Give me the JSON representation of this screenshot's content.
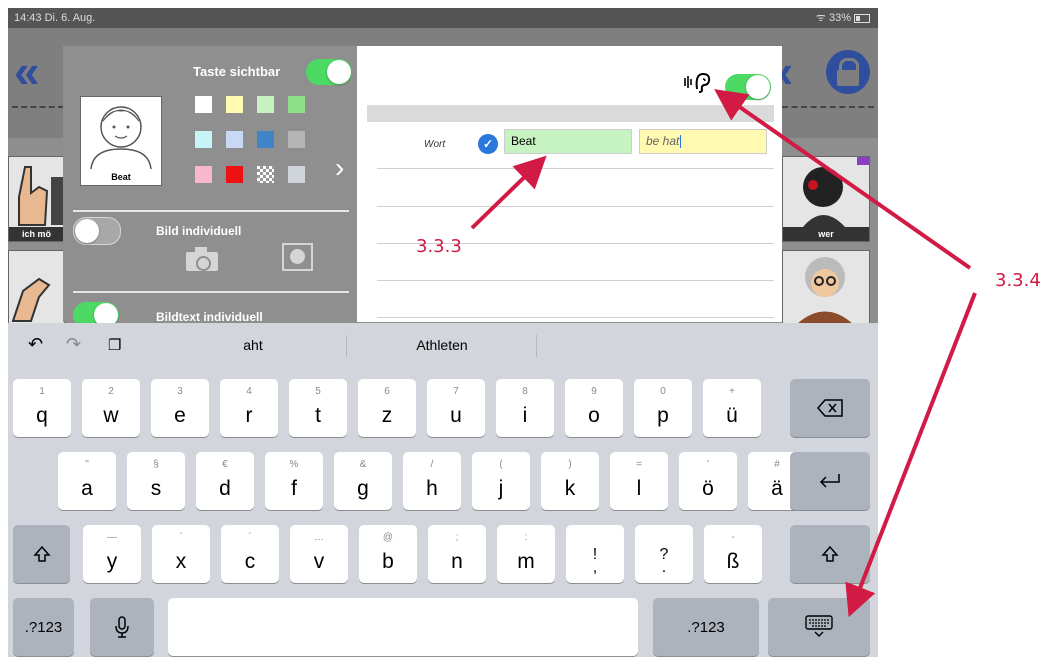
{
  "status": {
    "time_date": "14:43  Di. 6. Aug.",
    "battery": "33%"
  },
  "board": {
    "tile_ich_label": "ich mö",
    "tile_wer_label": "wer"
  },
  "left_panel": {
    "title": "Taste sichtbar",
    "avatar_name": "Beat",
    "swatches": [
      "#ffffff",
      "#fffab0",
      "#c6f2bf",
      "#90e08a",
      "#c7f5f7",
      "#c8d8f5",
      "#3f84c9",
      "#b5b5b5",
      "#f7b7cc",
      "#ee1111",
      "checker",
      "#d0d5db"
    ],
    "bild_label": "Bild individuell",
    "bildtext_label": "Bildtext individuell"
  },
  "right_panel": {
    "wort_label": "Wort",
    "word_value": "Beat",
    "speech_value": "be hat",
    "hearing_icon": "🕪 ear"
  },
  "keyboard": {
    "suggestions": [
      "aht",
      "Athleten"
    ],
    "rows": [
      [
        {
          "h": "1",
          "m": "q"
        },
        {
          "h": "2",
          "m": "w"
        },
        {
          "h": "3",
          "m": "e"
        },
        {
          "h": "4",
          "m": "r"
        },
        {
          "h": "5",
          "m": "t"
        },
        {
          "h": "6",
          "m": "z"
        },
        {
          "h": "7",
          "m": "u"
        },
        {
          "h": "8",
          "m": "i"
        },
        {
          "h": "9",
          "m": "o"
        },
        {
          "h": "0",
          "m": "p"
        },
        {
          "h": "+",
          "m": "ü"
        }
      ],
      [
        {
          "h": "\"",
          "m": "a"
        },
        {
          "h": "§",
          "m": "s"
        },
        {
          "h": "€",
          "m": "d"
        },
        {
          "h": "%",
          "m": "f"
        },
        {
          "h": "&",
          "m": "g"
        },
        {
          "h": "/",
          "m": "h"
        },
        {
          "h": "(",
          "m": "j"
        },
        {
          "h": ")",
          "m": "k"
        },
        {
          "h": "=",
          "m": "l"
        },
        {
          "h": "'",
          "m": "ö"
        },
        {
          "h": "#",
          "m": "ä"
        }
      ],
      [
        {
          "h": "—",
          "m": "y"
        },
        {
          "h": "`",
          "m": "x"
        },
        {
          "h": "´",
          "m": "c"
        },
        {
          "h": "…",
          "m": "v"
        },
        {
          "h": "@",
          "m": "b"
        },
        {
          "h": ";",
          "m": "n"
        },
        {
          "h": ":",
          "m": "m"
        },
        {
          "h": "",
          "m": "!\n,"
        },
        {
          "h": "",
          "m": "?\n."
        },
        {
          "h": "-",
          "m": "ß"
        }
      ]
    ],
    "num_label": ".?123",
    "num_label_right": ".?123"
  },
  "annotations": {
    "a1": "3.3.3",
    "a2": "3.3.4"
  }
}
